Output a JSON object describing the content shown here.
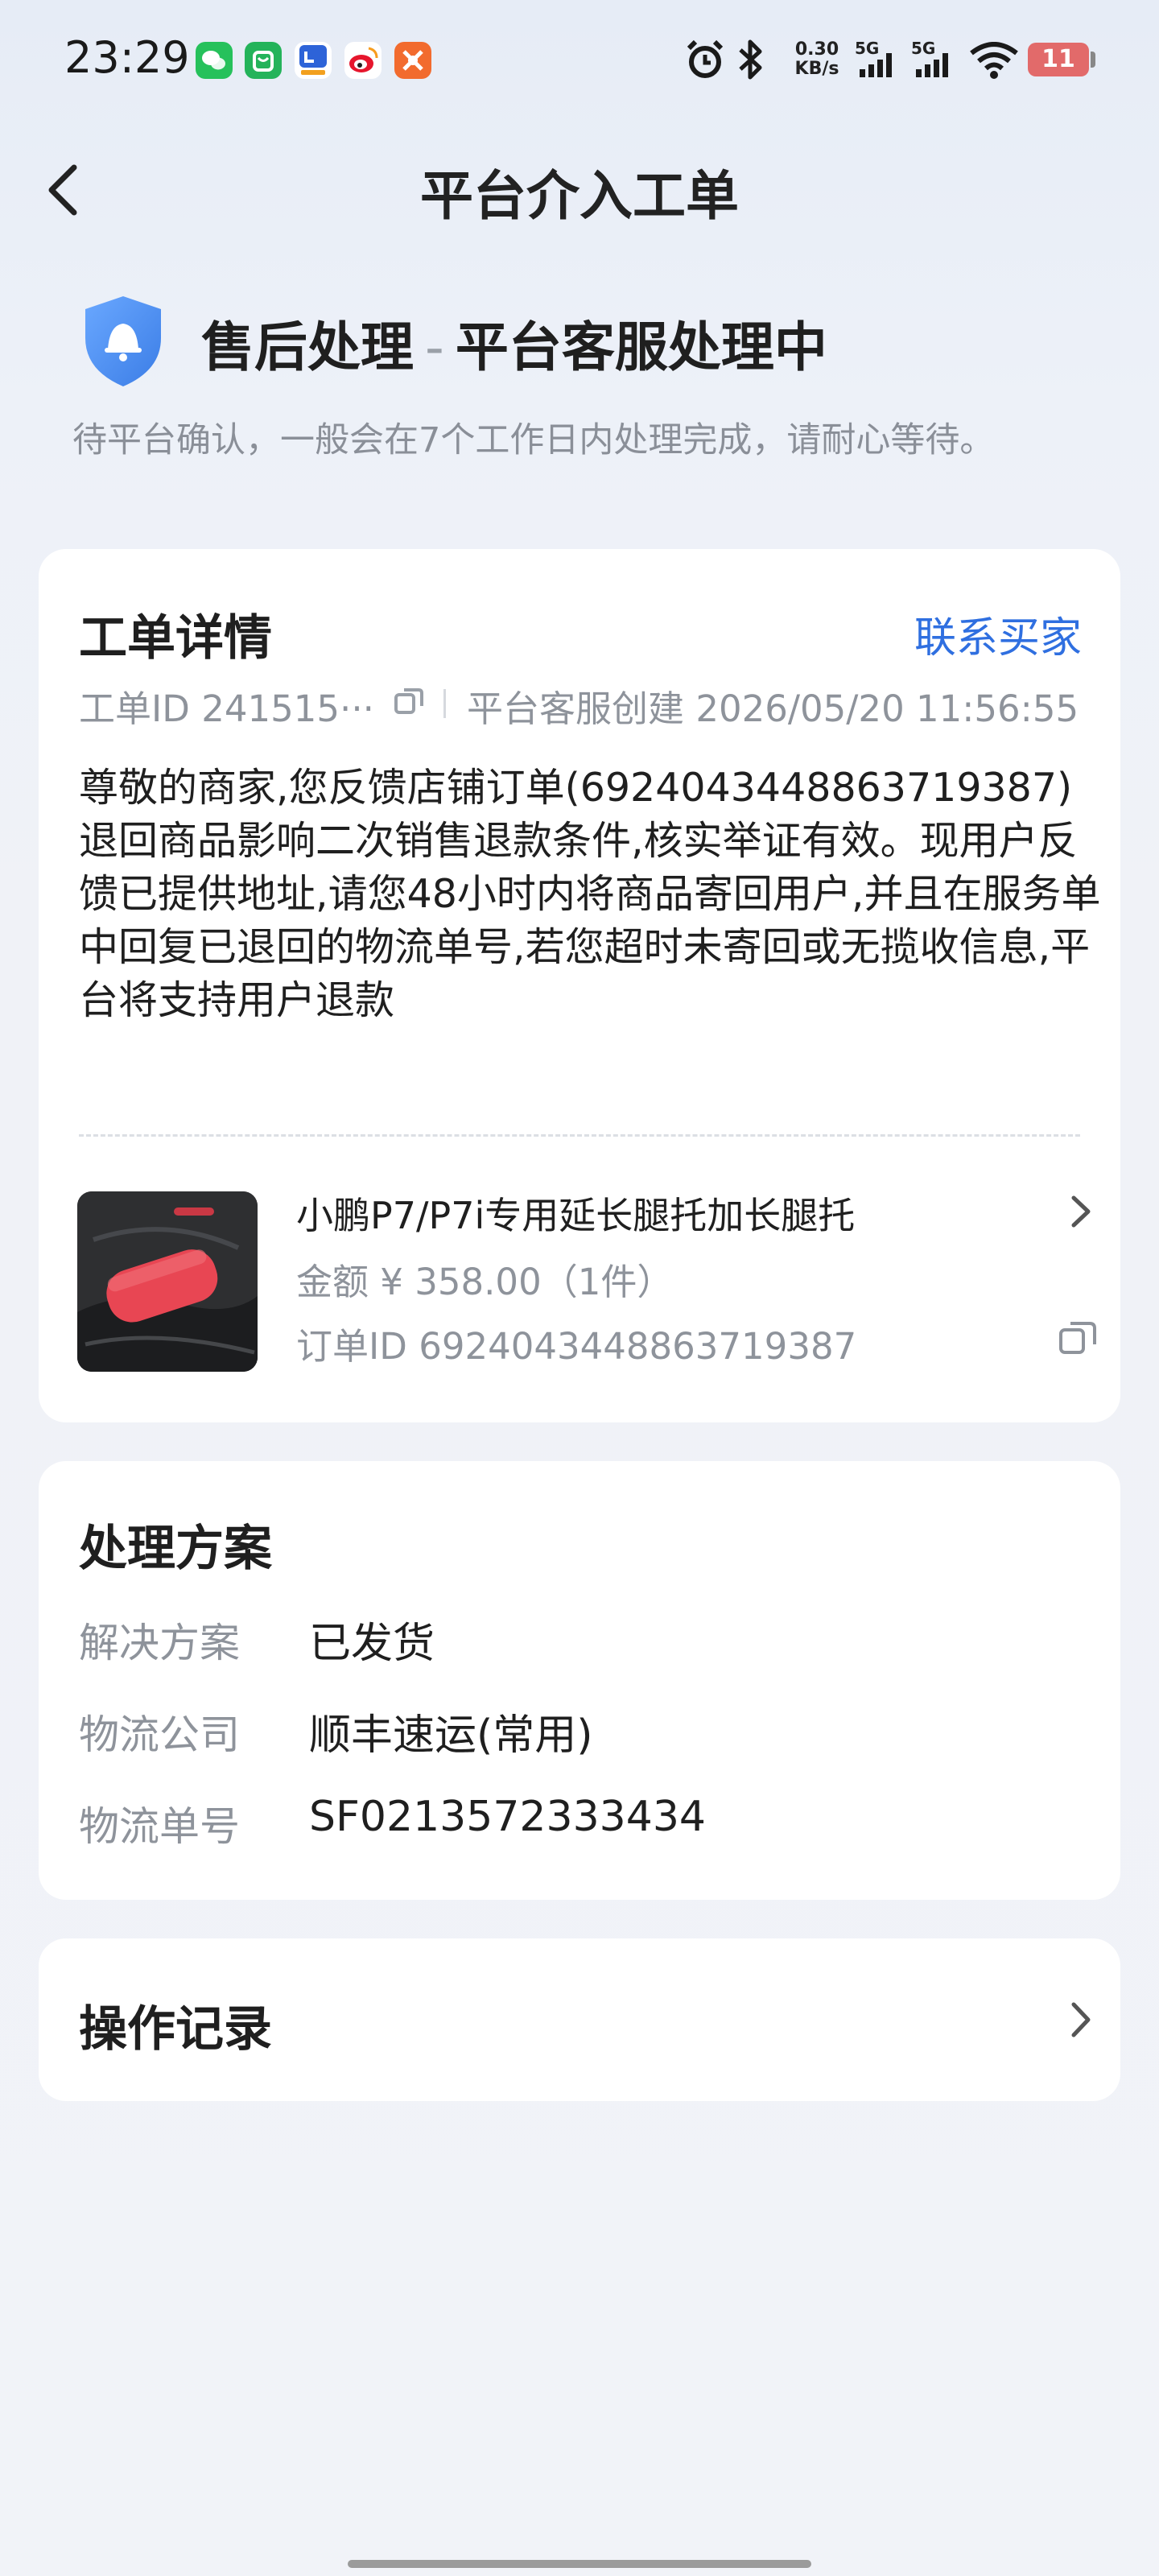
{
  "status_bar": {
    "time": "23:29",
    "net_speed_value": "0.30",
    "net_speed_unit": "KB/s",
    "signal1_label": "5G",
    "signal2_label": "5G",
    "battery": "11"
  },
  "nav": {
    "title": "平台介入工单"
  },
  "status": {
    "title": "售后处理",
    "separator": "-",
    "subtitle": "平台客服处理中",
    "description": "待平台确认，一般会在7个工作日内处理完成，请耐心等待。"
  },
  "ticket": {
    "title": "工单详情",
    "contact_link": "联系买家",
    "id_text": "工单ID 241515···",
    "creator": "平台客服创建",
    "created_at": "2026/05/20 11:56:55",
    "message": "尊敬的商家,您反馈店铺订单(6924043448863719387)退回商品影响二次销售退款条件,核实举证有效。现用户反馈已提供地址,请您48小时内将商品寄回用户,并且在服务单中回复已退回的物流单号,若您超时未寄回或无揽收信息,平台将支持用户退款",
    "product": {
      "name": "小鹏P7/P7i专用延长腿托加长腿托",
      "amount": "金额 ¥ 358.00（1件）",
      "order_id": "订单ID 6924043448863719387"
    }
  },
  "solution": {
    "title": "处理方案",
    "rows": [
      {
        "label": "解决方案",
        "value": "已发货"
      },
      {
        "label": "物流公司",
        "value": "顺丰速运(常用)"
      },
      {
        "label": "物流单号",
        "value": "SF0213572333434"
      }
    ]
  },
  "records": {
    "title": "操作记录"
  },
  "colors": {
    "accent_blue": "#2f6fe0",
    "shield_blue": "#4a90f0",
    "battery_low": "#e26a6a",
    "muted_text": "#8e939b"
  },
  "icons": [
    "back-arrow-icon",
    "shield-bell-icon",
    "copy-icon",
    "chevron-right-icon",
    "alarm-icon",
    "bluetooth-icon",
    "wifi-icon",
    "signal-icon"
  ]
}
